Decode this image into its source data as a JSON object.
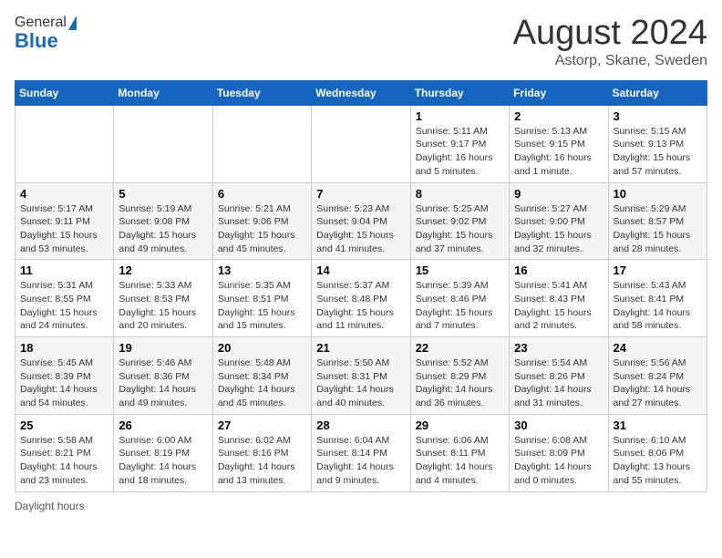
{
  "header": {
    "logo_general": "General",
    "logo_blue": "Blue",
    "month_title": "August 2024",
    "location": "Astorp, Skane, Sweden"
  },
  "days_of_week": [
    "Sunday",
    "Monday",
    "Tuesday",
    "Wednesday",
    "Thursday",
    "Friday",
    "Saturday"
  ],
  "weeks": [
    [
      {
        "day": "",
        "info": ""
      },
      {
        "day": "",
        "info": ""
      },
      {
        "day": "",
        "info": ""
      },
      {
        "day": "",
        "info": ""
      },
      {
        "day": "1",
        "info": "Sunrise: 5:11 AM\nSunset: 9:17 PM\nDaylight: 16 hours\nand 5 minutes."
      },
      {
        "day": "2",
        "info": "Sunrise: 5:13 AM\nSunset: 9:15 PM\nDaylight: 16 hours\nand 1 minute."
      },
      {
        "day": "3",
        "info": "Sunrise: 5:15 AM\nSunset: 9:13 PM\nDaylight: 15 hours\nand 57 minutes."
      }
    ],
    [
      {
        "day": "4",
        "info": "Sunrise: 5:17 AM\nSunset: 9:11 PM\nDaylight: 15 hours\nand 53 minutes."
      },
      {
        "day": "5",
        "info": "Sunrise: 5:19 AM\nSunset: 9:08 PM\nDaylight: 15 hours\nand 49 minutes."
      },
      {
        "day": "6",
        "info": "Sunrise: 5:21 AM\nSunset: 9:06 PM\nDaylight: 15 hours\nand 45 minutes."
      },
      {
        "day": "7",
        "info": "Sunrise: 5:23 AM\nSunset: 9:04 PM\nDaylight: 15 hours\nand 41 minutes."
      },
      {
        "day": "8",
        "info": "Sunrise: 5:25 AM\nSunset: 9:02 PM\nDaylight: 15 hours\nand 37 minutes."
      },
      {
        "day": "9",
        "info": "Sunrise: 5:27 AM\nSunset: 9:00 PM\nDaylight: 15 hours\nand 32 minutes."
      },
      {
        "day": "10",
        "info": "Sunrise: 5:29 AM\nSunset: 8:57 PM\nDaylight: 15 hours\nand 28 minutes."
      }
    ],
    [
      {
        "day": "11",
        "info": "Sunrise: 5:31 AM\nSunset: 8:55 PM\nDaylight: 15 hours\nand 24 minutes."
      },
      {
        "day": "12",
        "info": "Sunrise: 5:33 AM\nSunset: 8:53 PM\nDaylight: 15 hours\nand 20 minutes."
      },
      {
        "day": "13",
        "info": "Sunrise: 5:35 AM\nSunset: 8:51 PM\nDaylight: 15 hours\nand 15 minutes."
      },
      {
        "day": "14",
        "info": "Sunrise: 5:37 AM\nSunset: 8:48 PM\nDaylight: 15 hours\nand 11 minutes."
      },
      {
        "day": "15",
        "info": "Sunrise: 5:39 AM\nSunset: 8:46 PM\nDaylight: 15 hours\nand 7 minutes."
      },
      {
        "day": "16",
        "info": "Sunrise: 5:41 AM\nSunset: 8:43 PM\nDaylight: 15 hours\nand 2 minutes."
      },
      {
        "day": "17",
        "info": "Sunrise: 5:43 AM\nSunset: 8:41 PM\nDaylight: 14 hours\nand 58 minutes."
      }
    ],
    [
      {
        "day": "18",
        "info": "Sunrise: 5:45 AM\nSunset: 8:39 PM\nDaylight: 14 hours\nand 54 minutes."
      },
      {
        "day": "19",
        "info": "Sunrise: 5:46 AM\nSunset: 8:36 PM\nDaylight: 14 hours\nand 49 minutes."
      },
      {
        "day": "20",
        "info": "Sunrise: 5:48 AM\nSunset: 8:34 PM\nDaylight: 14 hours\nand 45 minutes."
      },
      {
        "day": "21",
        "info": "Sunrise: 5:50 AM\nSunset: 8:31 PM\nDaylight: 14 hours\nand 40 minutes."
      },
      {
        "day": "22",
        "info": "Sunrise: 5:52 AM\nSunset: 8:29 PM\nDaylight: 14 hours\nand 36 minutes."
      },
      {
        "day": "23",
        "info": "Sunrise: 5:54 AM\nSunset: 8:26 PM\nDaylight: 14 hours\nand 31 minutes."
      },
      {
        "day": "24",
        "info": "Sunrise: 5:56 AM\nSunset: 8:24 PM\nDaylight: 14 hours\nand 27 minutes."
      }
    ],
    [
      {
        "day": "25",
        "info": "Sunrise: 5:58 AM\nSunset: 8:21 PM\nDaylight: 14 hours\nand 23 minutes."
      },
      {
        "day": "26",
        "info": "Sunrise: 6:00 AM\nSunset: 8:19 PM\nDaylight: 14 hours\nand 18 minutes."
      },
      {
        "day": "27",
        "info": "Sunrise: 6:02 AM\nSunset: 8:16 PM\nDaylight: 14 hours\nand 13 minutes."
      },
      {
        "day": "28",
        "info": "Sunrise: 6:04 AM\nSunset: 8:14 PM\nDaylight: 14 hours\nand 9 minutes."
      },
      {
        "day": "29",
        "info": "Sunrise: 6:06 AM\nSunset: 8:11 PM\nDaylight: 14 hours\nand 4 minutes."
      },
      {
        "day": "30",
        "info": "Sunrise: 6:08 AM\nSunset: 8:09 PM\nDaylight: 14 hours\nand 0 minutes."
      },
      {
        "day": "31",
        "info": "Sunrise: 6:10 AM\nSunset: 8:06 PM\nDaylight: 13 hours\nand 55 minutes."
      }
    ]
  ],
  "footer": {
    "note": "Daylight hours"
  }
}
